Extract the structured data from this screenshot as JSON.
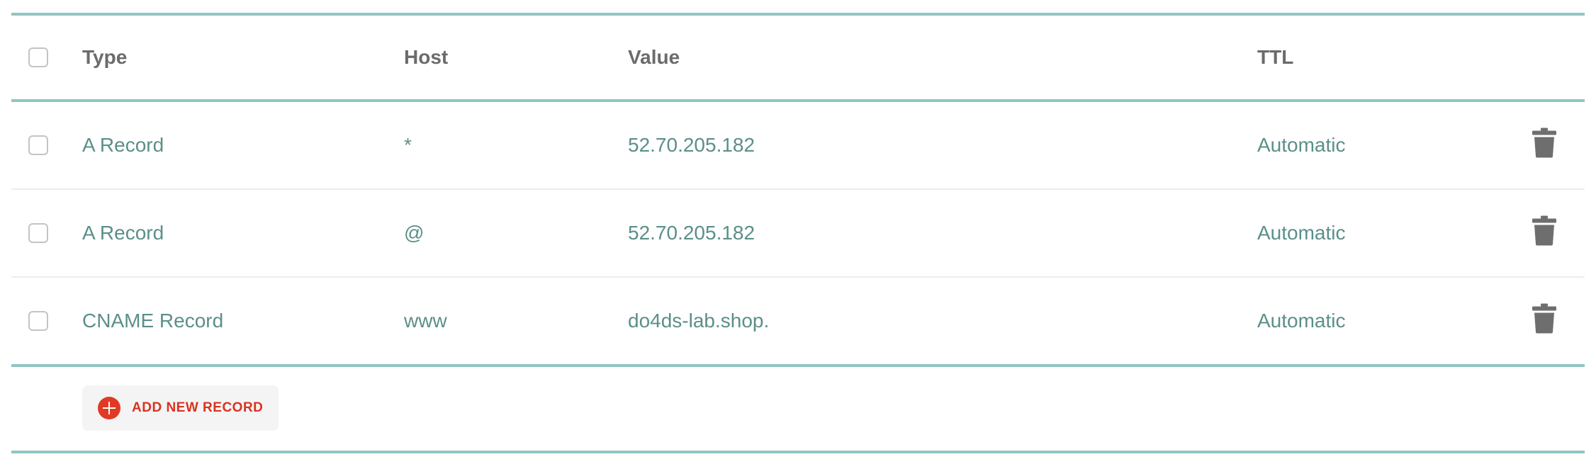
{
  "table": {
    "header": {
      "type": "Type",
      "host": "Host",
      "value": "Value",
      "ttl": "TTL"
    },
    "rows": [
      {
        "type": "A Record",
        "host": "*",
        "value": "52.70.205.182",
        "ttl": "Automatic"
      },
      {
        "type": "A Record",
        "host": "@",
        "value": "52.70.205.182",
        "ttl": "Automatic"
      },
      {
        "type": "CNAME Record",
        "host": "www",
        "value": "do4ds-lab.shop.",
        "ttl": "Automatic"
      }
    ]
  },
  "actions": {
    "add_record_label": "ADD NEW RECORD",
    "add_icon": "plus-circle-icon",
    "delete_icon": "trash-icon"
  },
  "colors": {
    "accent_teal": "#8fc6c2",
    "cell_text": "#5b8f8a",
    "header_text": "#6b6b6b",
    "add_red": "#e03a25",
    "trash_gray": "#6e6e6e"
  }
}
